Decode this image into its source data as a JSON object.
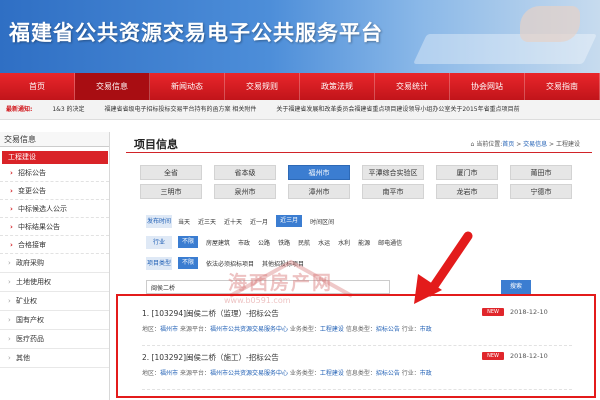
{
  "banner": {
    "title": "福建省公共资源交易电子公共服务平台"
  },
  "nav": [
    {
      "label": "首页"
    },
    {
      "label": "交易信息",
      "active": true
    },
    {
      "label": "新闻动态"
    },
    {
      "label": "交易规则"
    },
    {
      "label": "政策法规"
    },
    {
      "label": "交易统计"
    },
    {
      "label": "协会网站"
    },
    {
      "label": "交易指南"
    }
  ],
  "ticker": {
    "label": "最新通知:",
    "items": [
      "1&3 的决定",
      "福建省省级电子招标投标交易平台持有的函方案 相关附件",
      "关于福建省发展和改革委员会福建省重点项目建设领导小组办公室关于2015年省重点项目前"
    ]
  },
  "sidebar": {
    "title": "交易信息",
    "category": "工程建设",
    "subs": [
      "招标公告",
      "变更公告",
      "中标候选人公示",
      "中标结果公告",
      "合格接审"
    ],
    "items": [
      "政府采购",
      "土地使用权",
      "矿业权",
      "国有产权",
      "医疗药品",
      "其他"
    ]
  },
  "main": {
    "title": "项目信息",
    "breadcrumb": {
      "prefix": "当前位置:",
      "home": "首页",
      "sep1": " > ",
      "level1": "交易信息",
      "sep2": " > ",
      "level2": "工程建设"
    }
  },
  "regions": [
    {
      "label": "全省"
    },
    {
      "label": "省本级"
    },
    {
      "label": "福州市",
      "active": true
    },
    {
      "label": "平潭综合实验区"
    },
    {
      "label": "厦门市"
    },
    {
      "label": "莆田市"
    },
    {
      "label": "三明市"
    },
    {
      "label": "泉州市"
    },
    {
      "label": "漳州市"
    },
    {
      "label": "南平市"
    },
    {
      "label": "龙岩市"
    },
    {
      "label": "宁德市"
    }
  ],
  "filters": [
    {
      "label": "发布时间",
      "options": [
        {
          "t": "当天"
        },
        {
          "t": "近三天"
        },
        {
          "t": "近十天"
        },
        {
          "t": "近一月"
        },
        {
          "t": "近三月",
          "on": true
        },
        {
          "t": "时间区间"
        }
      ]
    },
    {
      "label": "行业",
      "options": [
        {
          "t": "不限",
          "on": true
        },
        {
          "t": "房屋建筑"
        },
        {
          "t": "市政"
        },
        {
          "t": "公路"
        },
        {
          "t": "铁路"
        },
        {
          "t": "民航"
        },
        {
          "t": "水运"
        },
        {
          "t": "水利"
        },
        {
          "t": "能源"
        },
        {
          "t": "邮电通信"
        }
      ]
    },
    {
      "label": "项目类型",
      "options": [
        {
          "t": "不限",
          "on": true
        },
        {
          "t": "依法必须招标项目"
        },
        {
          "t": "其他招投标项目"
        }
      ]
    }
  ],
  "search": {
    "value": "闽侯二桥",
    "button": "搜索"
  },
  "watermark": {
    "text": "海西房产网",
    "url": "www.b0591.com"
  },
  "results": [
    {
      "title": "1. [103294]闽侯二桥（监理）-招标公告",
      "badge": "NEW",
      "date": "2018-12-10",
      "meta": {
        "region_label": "地区：",
        "region": "福州市",
        "source_label": " 来源平台：",
        "source": "福州市公共资源交易服务中心",
        "biz_label": " 业务类型：",
        "biz": "工程建设",
        "info_label": " 信息类型：",
        "info": "招标公告",
        "industry_label": " 行业：",
        "industry": "市政"
      }
    },
    {
      "title": "2. [103292]闽侯二桥（施工）-招标公告",
      "badge": "NEW",
      "date": "2018-12-10",
      "meta": {
        "region_label": "地区：",
        "region": "福州市",
        "source_label": " 来源平台：",
        "source": "福州市公共资源交易服务中心",
        "biz_label": " 业务类型：",
        "biz": "工程建设",
        "info_label": " 信息类型：",
        "info": "招标公告",
        "industry_label": " 行业：",
        "industry": "市政"
      }
    }
  ],
  "colors": {
    "nav_red": "#d41d22",
    "accent_blue": "#3b7dd1",
    "highlight_box": "#e31b1b",
    "arrow": "#e31b1b"
  }
}
